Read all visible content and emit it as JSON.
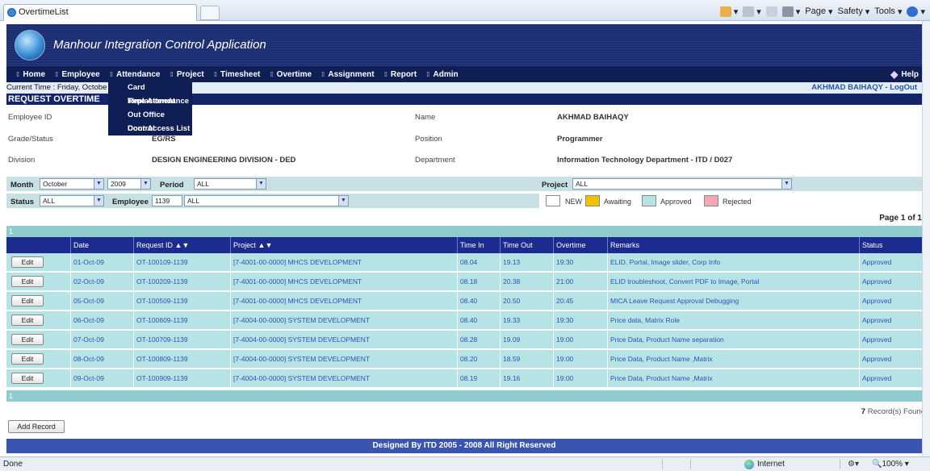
{
  "browser": {
    "tab_title": "OvertimeList",
    "commands": [
      "Page",
      "Safety",
      "Tools"
    ],
    "status_text": "Done",
    "zone": "Internet",
    "zoom": "100%"
  },
  "app": {
    "title": "Manhour Integration Control Application",
    "menu": [
      "Home",
      "Employee",
      "Attendance",
      "Project",
      "Timesheet",
      "Overtime",
      "Assignment",
      "Report",
      "Admin"
    ],
    "help": "Help",
    "dropdown_items": [
      "Card Replacement",
      "Time Attendance",
      "Out Office Control",
      "Door Access List"
    ],
    "current_time": "Current Time : Friday, Octobe",
    "user": "AKHMAD BAIHAQY",
    "user_sep": " - ",
    "logout": "LogOut",
    "section_title": "REQUEST OVERTIME"
  },
  "employee": {
    "employee_id_label": "Employee ID",
    "grade_label": "Grade/Status",
    "grade_value": "EG/RS",
    "division_label": "Division",
    "division_value": "DESIGN ENGINEERING DIVISION - DED",
    "name_label": "Name",
    "name_value": "AKHMAD BAIHAQY",
    "position_label": "Position",
    "position_value": "Programmer",
    "department_label": "Department",
    "department_value": "Information Technology Department - ITD / D027"
  },
  "filters": {
    "month_label": "Month",
    "month_value": "October",
    "year_value": "2009",
    "period_label": "Period",
    "period_value": "ALL",
    "project_label": "Project",
    "project_value": "ALL",
    "status_label": "Status",
    "status_value": "ALL",
    "employee_label": "Employee",
    "employee_id_value": "1139",
    "employee_value": "ALL",
    "legend": [
      {
        "label": "NEW",
        "color": "#ffffff"
      },
      {
        "label": "Awaiting",
        "color": "#f2c200"
      },
      {
        "label": "Approved",
        "color": "#b6e3e6"
      },
      {
        "label": "Rejected",
        "color": "#f4a8b4"
      }
    ]
  },
  "table": {
    "page_info": "Page 1 of 1",
    "page_number": "1",
    "headers": [
      "",
      "Date",
      "Request ID",
      "Project",
      "Time In",
      "Time Out",
      "Overtime",
      "Remarks",
      "Status"
    ],
    "sort_arrows": "▲▼",
    "edit_label": "Edit",
    "rows": [
      {
        "date": "01-Oct-09",
        "request_id": "OT-100109-1139",
        "project": "[7-4001-00-0000] MHCS DEVELOPMENT",
        "time_in": "08.04",
        "time_out": "19.13",
        "overtime": "19:30",
        "remarks": "ELID, Portal, Image slider, Corp Info",
        "status": "Approved"
      },
      {
        "date": "02-Oct-09",
        "request_id": "OT-100209-1139",
        "project": "[7-4001-00-0000] MHCS DEVELOPMENT",
        "time_in": "08.18",
        "time_out": "20.38",
        "overtime": "21:00",
        "remarks": "ELID troubleshoot, Convert PDF to Image, Portal",
        "status": "Approved"
      },
      {
        "date": "05-Oct-09",
        "request_id": "OT-100509-1139",
        "project": "[7-4001-00-0000] MHCS DEVELOPMENT",
        "time_in": "08.40",
        "time_out": "20.50",
        "overtime": "20:45",
        "remarks": "MICA Leave Request Approval Debugging",
        "status": "Approved"
      },
      {
        "date": "06-Oct-09",
        "request_id": "OT-100609-1139",
        "project": "[7-4004-00-0000] SYSTEM DEVELOPMENT",
        "time_in": "08.40",
        "time_out": "19.33",
        "overtime": "19:30",
        "remarks": "Price data, Matrix Role",
        "status": "Approved"
      },
      {
        "date": "07-Oct-09",
        "request_id": "OT-100709-1139",
        "project": "[7-4004-00-0000] SYSTEM DEVELOPMENT",
        "time_in": "08.28",
        "time_out": "19.09",
        "overtime": "19:00",
        "remarks": "Price Data, Product Name separation",
        "status": "Approved"
      },
      {
        "date": "08-Oct-09",
        "request_id": "OT-100809-1139",
        "project": "[7-4004-00-0000] SYSTEM DEVELOPMENT",
        "time_in": "08.20",
        "time_out": "18.59",
        "overtime": "19:00",
        "remarks": "Price Data, Product Name ,Matrix",
        "status": "Approved"
      },
      {
        "date": "09-Oct-09",
        "request_id": "OT-100909-1139",
        "project": "[7-4004-00-0000] SYSTEM DEVELOPMENT",
        "time_in": "08.19",
        "time_out": "19.16",
        "overtime": "19:00",
        "remarks": "Price Data, Product Name ,Matrix",
        "status": "Approved"
      }
    ],
    "record_count": "7",
    "record_suffix": " Record(s) Found",
    "add_record": "Add Record"
  },
  "footer": "Designed By ITD 2005 - 2008 All Right Reserved"
}
